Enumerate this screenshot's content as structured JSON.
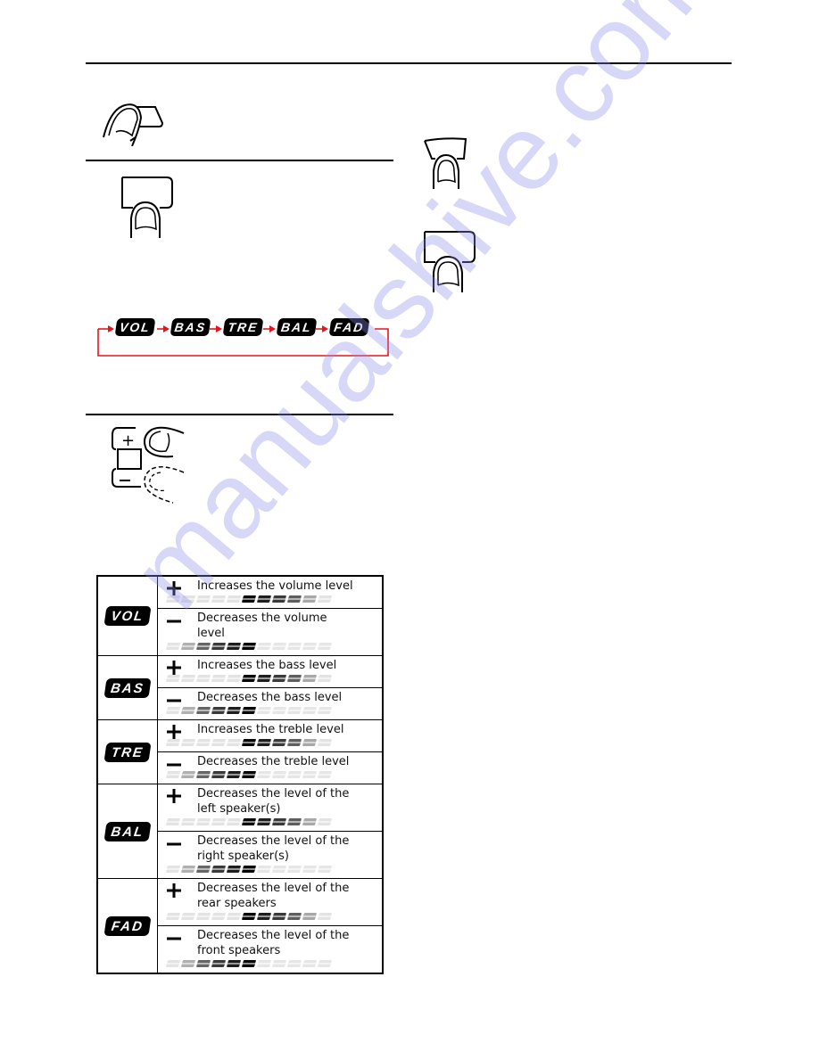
{
  "page": {
    "watermark": "manualshive.com"
  },
  "mode_flow": {
    "labels": [
      "VOL",
      "BAS",
      "TRE",
      "BAL",
      "FAD"
    ],
    "arrow_color": "#e8141b"
  },
  "controls_table": {
    "rows": [
      {
        "mode": "VOL",
        "plus": {
          "sign": "+",
          "text": "Increases the volume level",
          "level_pattern": "increase"
        },
        "minus": {
          "sign": "—",
          "text": "Decreases the volume level",
          "level_pattern": "decrease"
        }
      },
      {
        "mode": "BAS",
        "plus": {
          "sign": "+",
          "text": "Increases the bass level",
          "level_pattern": "increase"
        },
        "minus": {
          "sign": "—",
          "text": "Decreases the bass level",
          "level_pattern": "decrease"
        }
      },
      {
        "mode": "TRE",
        "plus": {
          "sign": "+",
          "text": "Increases the treble level",
          "level_pattern": "increase"
        },
        "minus": {
          "sign": "—",
          "text": "Decreases the treble level",
          "level_pattern": "decrease"
        }
      },
      {
        "mode": "BAL",
        "plus": {
          "sign": "+",
          "text": "Decreases the level of the left speaker(s)",
          "level_pattern": "increase"
        },
        "minus": {
          "sign": "—",
          "text": "Decreases the level of the right speaker(s)",
          "level_pattern": "decrease"
        }
      },
      {
        "mode": "FAD",
        "plus": {
          "sign": "+",
          "text": "Decreases the level of the rear speakers",
          "level_pattern": "increase"
        },
        "minus": {
          "sign": "—",
          "text": "Decreases the level of the front speakers",
          "level_pattern": "decrease"
        }
      }
    ],
    "meter_segments": 11,
    "increase_shades": [
      "#e3e3e3",
      "#e3e3e3",
      "#e3e3e3",
      "#e3e3e3",
      "#e3e3e3",
      "#000000",
      "#1e1e1e",
      "#3a3a3a",
      "#5e5e5e",
      "#a8a8a8",
      "#e3e3e3"
    ],
    "decrease_shades": [
      "#e3e3e3",
      "#b0b0b0",
      "#666666",
      "#3a3a3a",
      "#1e1e1e",
      "#000000",
      "#e6e6e6",
      "#e6e6e6",
      "#e6e6e6",
      "#e6e6e6",
      "#e6e6e6"
    ]
  }
}
